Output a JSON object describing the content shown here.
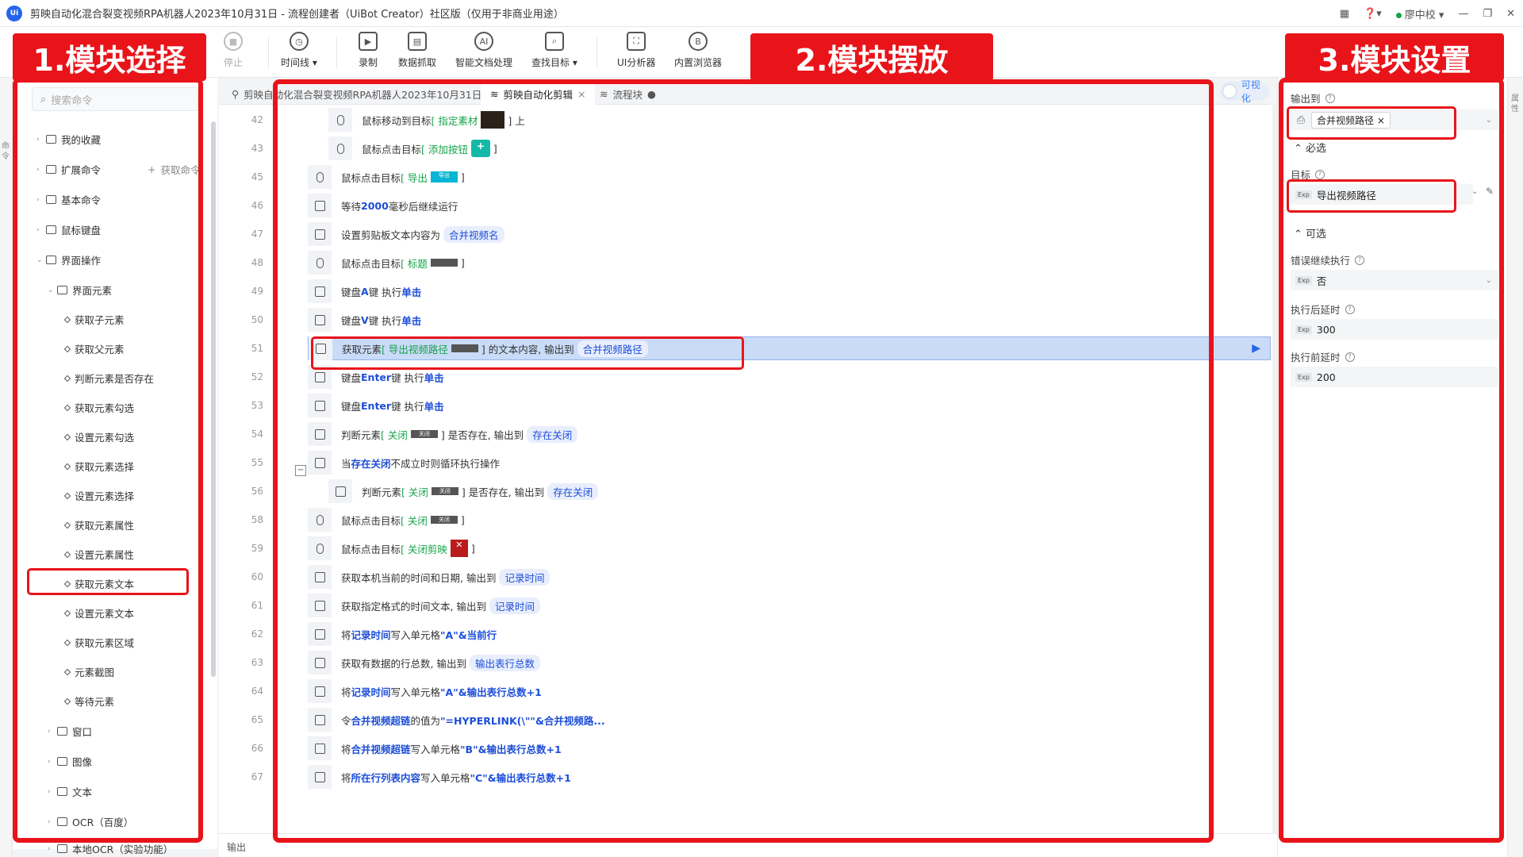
{
  "titlebar": {
    "logo": "Ui",
    "title": "剪映自动化混合裂变视频RPA机器人2023年10月31日 - 流程创建者（UiBot Creator）社区版（仅用于非商业用途）",
    "user": "廖中校",
    "icons": [
      "apps-icon",
      "help-icon",
      "minimize-icon",
      "restore-icon",
      "close-icon"
    ]
  },
  "toolbar": {
    "items": [
      {
        "label": "停止"
      },
      {
        "label": "时间线 ▾"
      },
      {
        "label": "录制"
      },
      {
        "label": "数据抓取"
      },
      {
        "label": "智能文档处理"
      },
      {
        "label": "查找目标 ▾"
      },
      {
        "label": "UI分析器"
      },
      {
        "label": "内置浏览器"
      }
    ]
  },
  "annotations": {
    "label1": "1.模块选择",
    "label2": "2.模块摆放",
    "label3": "3.模块设置"
  },
  "left": {
    "search_placeholder": "搜索命令",
    "get_command": "获取命令",
    "tree": [
      {
        "label": "我的收藏"
      },
      {
        "label": "扩展命令"
      },
      {
        "label": "基本命令"
      },
      {
        "label": "鼠标键盘"
      },
      {
        "label": "界面操作"
      },
      {
        "label": "界面元素"
      },
      {
        "label": "获取子元素"
      },
      {
        "label": "获取父元素"
      },
      {
        "label": "判断元素是否存在"
      },
      {
        "label": "获取元素勾选"
      },
      {
        "label": "设置元素勾选"
      },
      {
        "label": "获取元素选择"
      },
      {
        "label": "设置元素选择"
      },
      {
        "label": "获取元素属性"
      },
      {
        "label": "设置元素属性"
      },
      {
        "label": "获取元素文本"
      },
      {
        "label": "设置元素文本"
      },
      {
        "label": "获取元素区域"
      },
      {
        "label": "元素截图"
      },
      {
        "label": "等待元素"
      },
      {
        "label": "窗口"
      },
      {
        "label": "图像"
      },
      {
        "label": "文本"
      },
      {
        "label": "OCR（百度）"
      },
      {
        "label": "本地OCR（实验功能）"
      }
    ]
  },
  "tabs": [
    {
      "label": "剪映自动化混合裂变视频RPA机器人2023年10月31日"
    },
    {
      "label": "剪映自动化剪辑"
    },
    {
      "label": "流程块"
    }
  ],
  "visual_toggle": "可视化",
  "editor": {
    "lines": [
      {
        "n": "42",
        "a": "鼠标移动到目标",
        "b": "[ 指定素材",
        "c": " ] 上"
      },
      {
        "n": "43",
        "a": "鼠标点击目标",
        "b": "[ 添加按钮",
        "c": " ]"
      },
      {
        "n": "45",
        "a": "鼠标点击目标",
        "b": "[ 导出",
        "c": " ]"
      },
      {
        "n": "46",
        "a": "等待 ",
        "k": "2000",
        "c": " 毫秒后继续运行"
      },
      {
        "n": "47",
        "a": "设置剪贴板文本内容为 ",
        "v": "合并视频名"
      },
      {
        "n": "48",
        "a": "鼠标点击目标",
        "b": "[ 标题",
        "c": " ]"
      },
      {
        "n": "49",
        "a": "键盘 ",
        "k": "A",
        "c": " 键 执行 ",
        "k2": "单击"
      },
      {
        "n": "50",
        "a": "键盘 ",
        "k": "V",
        "c": " 键 执行 ",
        "k2": "单击"
      },
      {
        "n": "51",
        "a": "获取元素",
        "b": "[ 导出视频路径",
        "c": " ] 的文本内容, 输出到",
        "v": "合并视频路径"
      },
      {
        "n": "52",
        "a": "键盘 ",
        "k": "Enter",
        "c": " 键 执行 ",
        "k2": "单击"
      },
      {
        "n": "53",
        "a": "键盘 ",
        "k": "Enter",
        "c": " 键 执行 ",
        "k2": "单击"
      },
      {
        "n": "54",
        "a": "判断元素",
        "b": "[ 关闭",
        "c": " ] 是否存在, 输出到",
        "v": "存在关闭"
      },
      {
        "n": "55",
        "a": "当 ",
        "k": "存在关闭",
        "c": " 不成立时则循环执行操作"
      },
      {
        "n": "56",
        "a": "判断元素",
        "b": "[ 关闭",
        "c": " ] 是否存在, 输出到",
        "v": "存在关闭"
      },
      {
        "n": "58",
        "a": "鼠标点击目标",
        "b": "[ 关闭",
        "c": " ]"
      },
      {
        "n": "59",
        "a": "鼠标点击目标",
        "b": "[ 关闭剪映",
        "c": " ]"
      },
      {
        "n": "60",
        "a": "获取本机当前的时间和日期, 输出到",
        "v": "记录时间"
      },
      {
        "n": "61",
        "a": "获取指定格式的时间文本, 输出到",
        "v": "记录时间"
      },
      {
        "n": "62",
        "a": "将 ",
        "k": "记录时间",
        "c": " 写入单元格 ",
        "k2": "\"A\"&当前行"
      },
      {
        "n": "63",
        "a": "获取有数据的行总数, 输出到",
        "v": "输出表行总数"
      },
      {
        "n": "64",
        "a": "将 ",
        "k": "记录时间",
        "c": " 写入单元格 ",
        "k2": "\"A\"&输出表行总数+1"
      },
      {
        "n": "65",
        "a": "令 ",
        "k": "合并视频超链",
        "c": " 的值为 ",
        "k2": "\"=HYPERLINK(\\\"\"&合并视频路..."
      },
      {
        "n": "66",
        "a": "将 ",
        "k": "合并视频超链",
        "c": " 写入单元格 ",
        "k2": "\"B\"&输出表行总数+1"
      },
      {
        "n": "67",
        "a": "将 ",
        "k": "所在行列表内容",
        "c": " 写入单元格 ",
        "k2": "\"C\"&输出表行总数+1"
      }
    ],
    "thumb_text": {
      "export": "导出",
      "close": "关闭"
    },
    "output_label": "输出"
  },
  "right": {
    "output_label": "输出到",
    "output_value": "合并视频路径",
    "required_label": "必选",
    "target_label": "目标",
    "target_value": "导出视频路径",
    "optional_label": "可选",
    "error_label": "错误继续执行",
    "error_value": "否",
    "delay_after_label": "执行后延时",
    "delay_after_value": "300",
    "delay_before_label": "执行前延时",
    "delay_before_value": "200",
    "exp": "Exp",
    "side_left": "命令",
    "side_right": "属性"
  },
  "colors": {
    "annotation_red": "#e8141a",
    "accent_blue": "#1d4ed8",
    "target_green": "#16a34a",
    "selected_row": "#c9dbf7"
  }
}
